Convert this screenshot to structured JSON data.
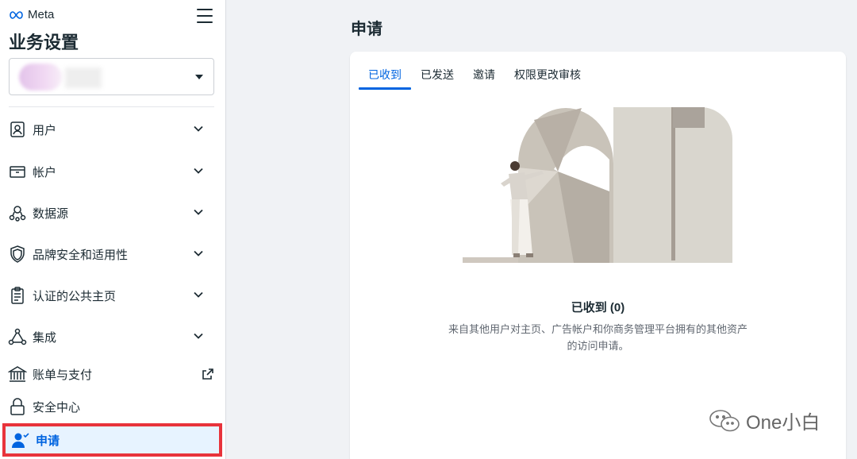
{
  "sidebar": {
    "brand": "Meta",
    "title": "业务设置",
    "items": [
      {
        "label": "用户",
        "icon": "user-card-icon"
      },
      {
        "label": "帐户",
        "icon": "inbox-tray-icon"
      },
      {
        "label": "数据源",
        "icon": "people-group-icon"
      },
      {
        "label": "品牌安全和适用性",
        "icon": "shield-icon"
      },
      {
        "label": "认证的公共主页",
        "icon": "clipboard-icon"
      },
      {
        "label": "集成",
        "icon": "network-icon"
      },
      {
        "label": "账单与支付",
        "icon": "bank-icon"
      },
      {
        "label": "安全中心",
        "icon": "lock-icon"
      },
      {
        "label": "申请",
        "icon": "user-check-icon"
      }
    ]
  },
  "main": {
    "page_title": "申请",
    "tabs": [
      {
        "label": "已收到",
        "active": true
      },
      {
        "label": "已发送",
        "active": false
      },
      {
        "label": "邀请",
        "active": false
      },
      {
        "label": "权限更改审核",
        "active": false
      }
    ],
    "empty_state": {
      "title": "已收到 (0)",
      "description": "来自其他用户对主页、广告帐户和你商务管理平台拥有的其他资产的访问申请。"
    }
  },
  "watermark": "One小白",
  "colors": {
    "accent": "#0064e0",
    "highlight_border": "#e8333b",
    "active_bg": "#e7f3ff"
  }
}
